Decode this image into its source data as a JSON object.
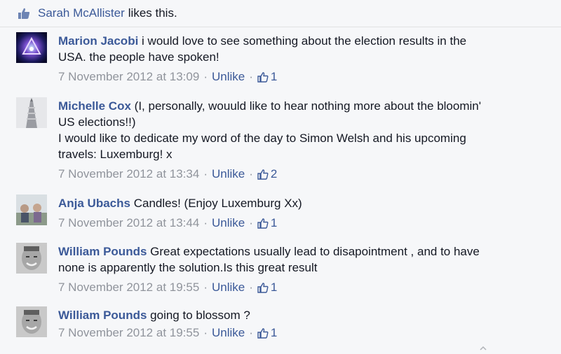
{
  "likes": {
    "liker": "Sarah McAllister",
    "text": "likes this."
  },
  "comments": [
    {
      "author": "Marion Jacobi",
      "lines": [
        "i would love to see something about the election results in the",
        "USA. the people have spoken!"
      ],
      "time": "7 November 2012 at 13:09",
      "action": "Unlike",
      "like_count": "1"
    },
    {
      "author": "Michelle Cox",
      "lines": [
        "(I, personally, wouuld like to hear nothing more about the bloomin'",
        "US elections!!)",
        "I would like to dedicate my word of the day to Simon Welsh and his upcoming",
        "travels: Luxemburg! x"
      ],
      "time": "7 November 2012 at 13:34",
      "action": "Unlike",
      "like_count": "2"
    },
    {
      "author": "Anja Ubachs",
      "lines": [
        "Candles! (Enjoy Luxemburg Xx)"
      ],
      "time": "7 November 2012 at 13:44",
      "action": "Unlike",
      "like_count": "1"
    },
    {
      "author": "William Pounds",
      "lines": [
        "Great expectations usually lead to disapointment , and to have",
        "none is apparently the solution.Is this great result"
      ],
      "time": "7 November 2012 at 19:55",
      "action": "Unlike",
      "like_count": "1"
    },
    {
      "author": "William Pounds",
      "lines": [
        "going to blossom ?"
      ],
      "time": "7 November 2012 at 19:55",
      "action": "Unlike",
      "like_count": "1"
    }
  ],
  "separator": "·",
  "colors": {
    "link": "#3b5998",
    "meta": "#90949c",
    "text": "#141823",
    "background": "#f6f7f9"
  }
}
